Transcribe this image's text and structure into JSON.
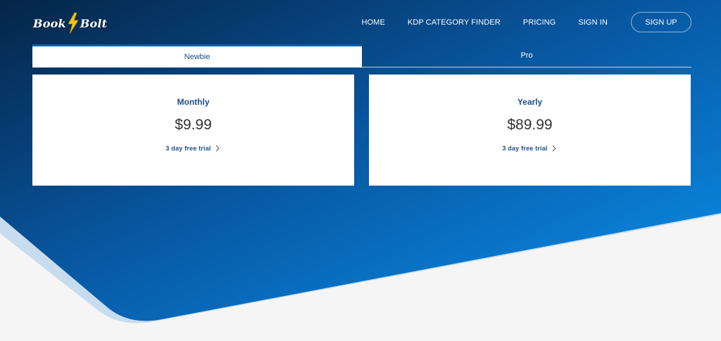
{
  "brand": {
    "part1": "Book",
    "part2": "Bolt",
    "icon": "lightning-bolt-icon"
  },
  "nav": {
    "home": "HOME",
    "category_finder": "KDP CATEGORY FINDER",
    "pricing": "PRICING",
    "sign_in": "SIGN IN",
    "sign_up": "SIGN UP"
  },
  "tabs": {
    "items": [
      {
        "label": "Newbie",
        "active": true
      },
      {
        "label": "Pro",
        "active": false
      }
    ]
  },
  "plans": [
    {
      "name": "Monthly",
      "price": "$9.99",
      "trial": "3 day free trial"
    },
    {
      "name": "Yearly",
      "price": "$89.99",
      "trial": "3 day free trial"
    }
  ],
  "colors": {
    "bg_dark": "#062d55",
    "bg_mid": "#0a5aa6",
    "bg_light": "#0a8de6",
    "accent_text": "#1c4f8a",
    "bolt_yellow": "#f5c518",
    "footer_bg": "#f5f5f5",
    "wave_light": "#c7dcee"
  }
}
